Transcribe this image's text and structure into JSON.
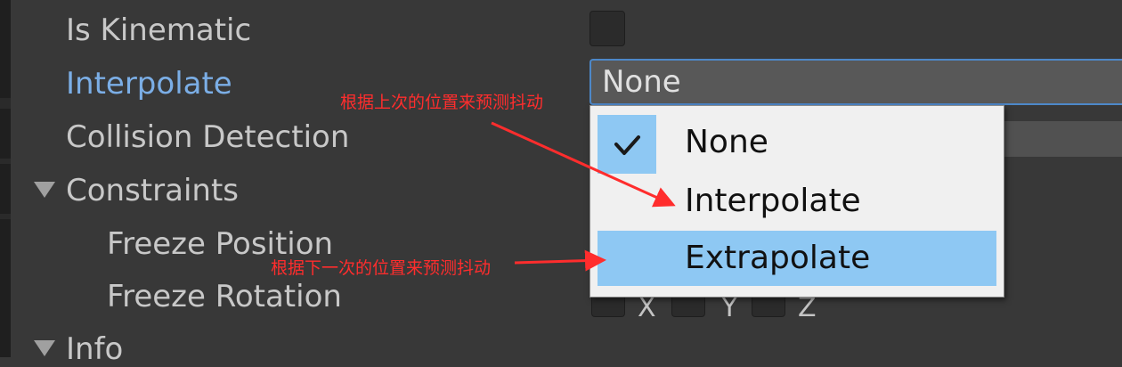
{
  "inspector": {
    "properties": [
      {
        "label": "Is Kinematic"
      },
      {
        "label": "Interpolate"
      },
      {
        "label": "Collision Detection"
      },
      {
        "label": "Constraints"
      },
      {
        "label": "Freeze Position"
      },
      {
        "label": "Freeze Rotation"
      },
      {
        "label": "Info"
      }
    ],
    "is_kinematic_checked": false,
    "freeze_rotation_axes": [
      "X",
      "Y",
      "Z"
    ]
  },
  "interpolate_dropdown": {
    "selected_value": "None",
    "options": [
      {
        "label": "None",
        "checked": true
      },
      {
        "label": "Interpolate",
        "checked": false
      },
      {
        "label": "Extrapolate",
        "checked": false,
        "highlighted": true
      }
    ]
  },
  "annotations": [
    {
      "text": "根据上次的位置来预测抖动"
    },
    {
      "text": "根据下一次的位置来预测抖动"
    }
  ],
  "colors": {
    "background": "#383838",
    "active_label": "#7baee6",
    "menu_highlight": "#8ec8f3",
    "annotation": "#ff2d2d"
  }
}
